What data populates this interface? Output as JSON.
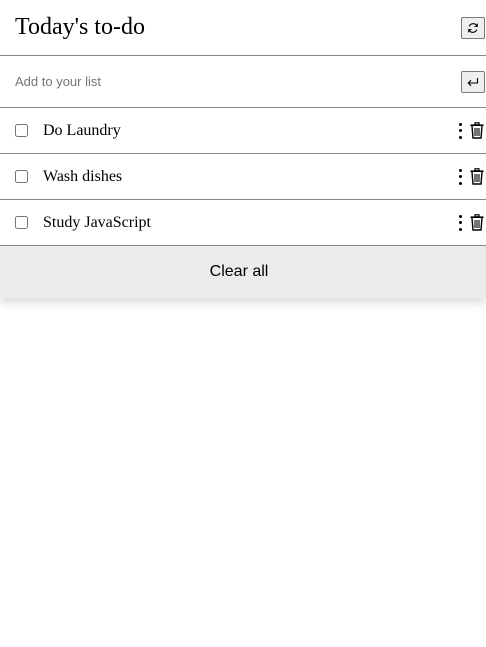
{
  "header": {
    "title": "Today's to-do",
    "refresh_icon": "refresh-icon"
  },
  "add": {
    "placeholder": "Add to your list",
    "submit_icon": "enter-icon"
  },
  "tasks": [
    {
      "label": "Do Laundry",
      "checked": false
    },
    {
      "label": "Wash dishes",
      "checked": false
    },
    {
      "label": "Study JavaScript",
      "checked": false
    }
  ],
  "footer": {
    "clear_label": "Clear all"
  },
  "colors": {
    "divider": "#888888",
    "clear_bg": "#ececec"
  }
}
